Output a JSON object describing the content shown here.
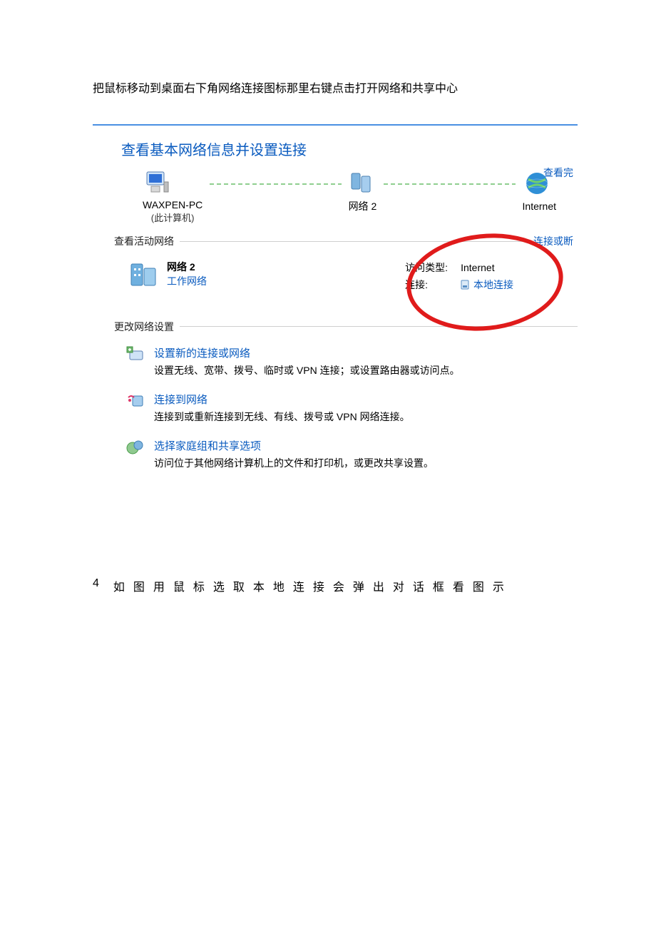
{
  "instruction1": "把鼠标移动到桌面右下角网络连接图标那里右键点击打开网络和共享中心",
  "panel": {
    "title": "查看基本网络信息并设置连接",
    "see_full_map": "查看完",
    "topo": {
      "pc_name": "WAXPEN-PC",
      "pc_sub": "(此计算机)",
      "middle": "网络  2",
      "internet": "Internet"
    },
    "active_hdr": "查看活动网络",
    "active_link": "连接或断",
    "active": {
      "name": "网络  2",
      "type": "工作网络",
      "access_label": "访问类型:",
      "access_value": "Internet",
      "conn_label": "连接:",
      "conn_value": "本地连接"
    },
    "settings_hdr": "更改网络设置",
    "items": [
      {
        "title": "设置新的连接或网络",
        "desc": "设置无线、宽带、拨号、临时或 VPN 连接；或设置路由器或访问点。"
      },
      {
        "title": "连接到网络",
        "desc": "连接到或重新连接到无线、有线、拨号或 VPN 网络连接。"
      },
      {
        "title": "选择家庭组和共享选项",
        "desc": "访问位于其他网络计算机上的文件和打印机，或更改共享设置。"
      }
    ]
  },
  "instruction2_num": "4",
  "instruction2_text": "如图用鼠标选取本地连接会弹出对话框看图示"
}
